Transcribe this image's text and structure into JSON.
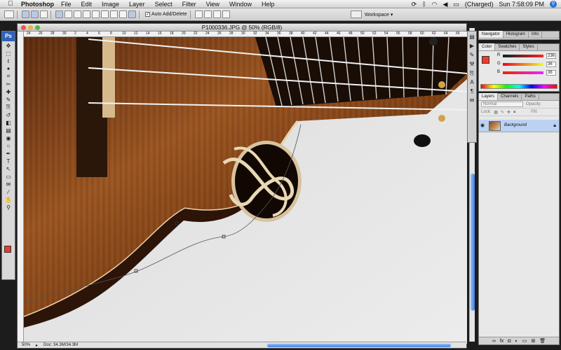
{
  "menubar": {
    "apple": "",
    "app": "Photoshop",
    "menus": [
      "File",
      "Edit",
      "Image",
      "Layer",
      "Select",
      "Filter",
      "View",
      "Window",
      "Help"
    ],
    "battery": "(Charged)",
    "clock": "Sun 7:58:09 PM",
    "spotlight_icon": "spotlight-icon"
  },
  "options": {
    "auto_add_delete": "Auto Add/Delete",
    "auto_add_checked": true,
    "workspace": "Workspace ▾"
  },
  "document": {
    "title": "P1000336.JPG @ 50% (RGB/8)",
    "zoom": "50%",
    "doc_size": "Doc: 34.3M/34.3M",
    "ruler_ticks": [
      "24",
      "26",
      "28",
      "30",
      "2",
      "4",
      "6",
      "8",
      "10",
      "12",
      "14",
      "16",
      "18",
      "20",
      "22",
      "24",
      "26",
      "28",
      "30",
      "32",
      "34",
      "36",
      "38",
      "40",
      "42",
      "44",
      "46",
      "48",
      "50",
      "52",
      "54",
      "56",
      "58",
      "60",
      "62",
      "64",
      "66"
    ]
  },
  "tools": {
    "logo": "Ps",
    "items": [
      "move-tool",
      "marquee-tool",
      "lasso-tool",
      "magic-wand-tool",
      "crop-tool",
      "slice-tool",
      "healing-tool",
      "brush-tool",
      "clone-stamp-tool",
      "history-brush-tool",
      "eraser-tool",
      "gradient-tool",
      "blur-tool",
      "dodge-tool",
      "pen-tool",
      "type-tool",
      "path-select-tool",
      "shape-tool",
      "notes-tool",
      "eyedropper-tool",
      "hand-tool",
      "zoom-tool"
    ],
    "glyphs": [
      "✥",
      "⬚",
      "ℓ",
      "✦",
      "⌗",
      "✂",
      "✚",
      "✎",
      "⎘",
      "↺",
      "◧",
      "▤",
      "◉",
      "○",
      "✒",
      "T",
      "↖",
      "▭",
      "✉",
      "⁄",
      "✋",
      "⚲"
    ],
    "foreground_color": "#EC3B2C",
    "background_color": "#FFFFFF"
  },
  "panels": {
    "top_tabs": [
      "Navigator",
      "Histogram",
      "Info"
    ],
    "color_tabs": [
      "Color",
      "Swatches",
      "Styles"
    ],
    "color": {
      "r_label": "R",
      "g_label": "G",
      "b_label": "B",
      "r": "236",
      "g": "36",
      "b": "36",
      "swatch": "#EC3B2C"
    },
    "layers_tabs": [
      "Layers",
      "Channels",
      "Paths"
    ],
    "blend_mode": "Normal",
    "opacity_label": "Opacity:",
    "lock_label": "Lock:",
    "fill_label": "Fill:",
    "layer_name": "Background",
    "footer_icons": [
      "link-icon",
      "fx-icon",
      "mask-icon",
      "adjustment-icon",
      "folder-icon",
      "new-layer-icon",
      "trash-icon"
    ]
  }
}
